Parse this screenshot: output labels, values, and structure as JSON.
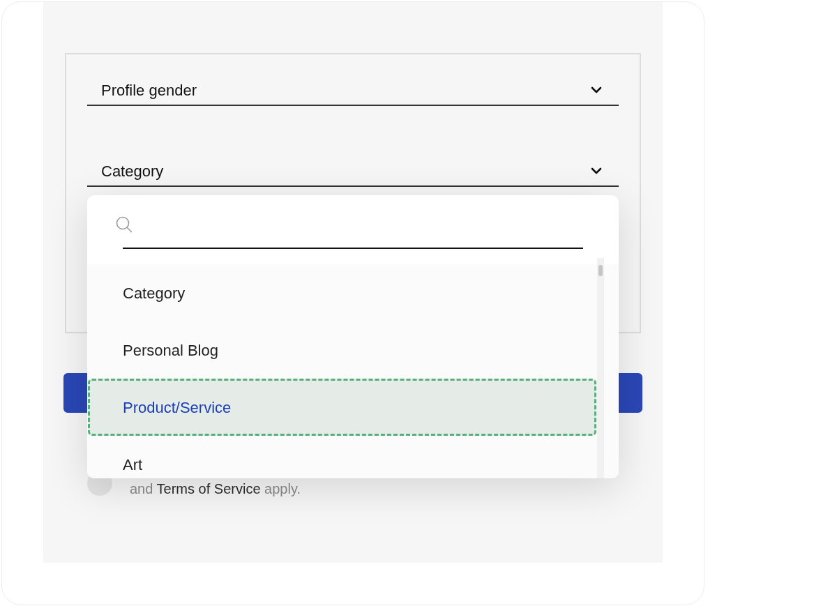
{
  "form": {
    "fields": [
      {
        "kind": "select",
        "label": "Profile gender"
      },
      {
        "kind": "select",
        "label": "Category",
        "dropdown": {
          "options": [
            {
              "label": "Category",
              "selected": false
            },
            {
              "label": "Personal Blog",
              "selected": false
            },
            {
              "label": "Product/Service",
              "selected": true
            },
            {
              "label": "Art",
              "selected": false
            }
          ]
        }
      }
    ]
  },
  "notice": [
    {
      "kind": "plain",
      "text": "and"
    },
    {
      "kind": "link",
      "text": "Terms of Service"
    },
    {
      "kind": "plain",
      "text": "apply."
    }
  ]
}
